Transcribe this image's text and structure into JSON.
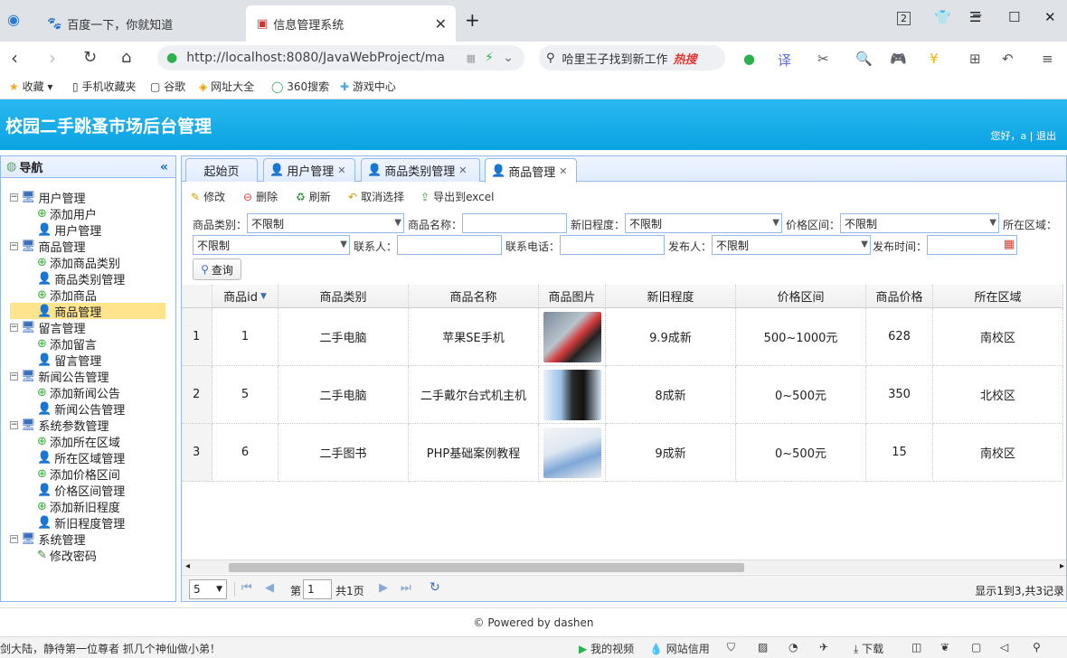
{
  "browser": {
    "tabs": [
      {
        "label": "百度一下，你就知道"
      },
      {
        "label": "信息管理系统"
      }
    ],
    "new_tab": "+",
    "tab_count": "2",
    "url": "http://localhost:8080/JavaWebProject/ma",
    "search_text": "哈里王子找到新工作",
    "search_hot": "热搜"
  },
  "bookmarks": [
    {
      "label": "收藏"
    },
    {
      "label": "手机收藏夹"
    },
    {
      "label": "谷歌"
    },
    {
      "label": "网址大全"
    },
    {
      "label": "360搜索"
    },
    {
      "label": "游戏中心"
    }
  ],
  "app": {
    "title": "校园二手跳蚤市场后台管理",
    "greeting": "您好，a",
    "logout": "退出"
  },
  "sidebar": {
    "title": "导航",
    "tree": [
      {
        "label": "用户管理",
        "children": [
          {
            "label": "添加用户"
          },
          {
            "label": "用户管理"
          }
        ]
      },
      {
        "label": "商品管理",
        "children": [
          {
            "label": "添加商品类别"
          },
          {
            "label": "商品类别管理"
          },
          {
            "label": "添加商品"
          },
          {
            "label": "商品管理"
          }
        ]
      },
      {
        "label": "留言管理",
        "children": [
          {
            "label": "添加留言"
          },
          {
            "label": "留言管理"
          }
        ]
      },
      {
        "label": "新闻公告管理",
        "children": [
          {
            "label": "添加新闻公告"
          },
          {
            "label": "新闻公告管理"
          }
        ]
      },
      {
        "label": "系统参数管理",
        "children": [
          {
            "label": "添加所在区域"
          },
          {
            "label": "所在区域管理"
          },
          {
            "label": "添加价格区间"
          },
          {
            "label": "价格区间管理"
          },
          {
            "label": "添加新旧程度"
          },
          {
            "label": "新旧程度管理"
          }
        ]
      },
      {
        "label": "系统管理",
        "children": [
          {
            "label": "修改密码"
          }
        ]
      }
    ]
  },
  "main_tabs": [
    {
      "label": "起始页"
    },
    {
      "label": "用户管理"
    },
    {
      "label": "商品类别管理"
    },
    {
      "label": "商品管理"
    }
  ],
  "toolbar": {
    "edit": "修改",
    "delete": "删除",
    "refresh": "刷新",
    "cancel": "取消选择",
    "export": "导出到excel"
  },
  "filters": {
    "category_label": "商品类别：",
    "category_value": "不限制",
    "name_label": "商品名称：",
    "condition_label": "新旧程度：",
    "condition_value": "不限制",
    "price_label": "价格区间：",
    "price_value": "不限制",
    "area_label": "所在区域：",
    "area_value": "不限制",
    "contact_label": "联系人：",
    "phone_label": "联系电话：",
    "publisher_label": "发布人：",
    "publisher_value": "不限制",
    "time_label": "发布时间：",
    "query": "查询"
  },
  "grid": {
    "headers": [
      "商品id",
      "商品类别",
      "商品名称",
      "商品图片",
      "新旧程度",
      "价格区间",
      "商品价格",
      "所在区域"
    ],
    "rows": [
      {
        "n": "1",
        "id": "1",
        "cat": "二手电脑",
        "name": "苹果SE手机",
        "cond": "9.9成新",
        "range": "500~1000元",
        "price": "628",
        "area": "南校区"
      },
      {
        "n": "2",
        "id": "5",
        "cat": "二手电脑",
        "name": "二手戴尔台式机主机",
        "cond": "8成新",
        "range": "0~500元",
        "price": "350",
        "area": "北校区"
      },
      {
        "n": "3",
        "id": "6",
        "cat": "二手图书",
        "name": "PHP基础案例教程",
        "cond": "9成新",
        "range": "0~500元",
        "price": "15",
        "area": "南校区"
      }
    ]
  },
  "pager": {
    "size": "5",
    "page_prefix": "第",
    "page": "1",
    "total_pages": "共1页",
    "summary": "显示1到3,共3记录"
  },
  "footer": "© Powered by dashen",
  "status": {
    "left": "剑大陆，静待第一位尊者 抓几个神仙做小弟！",
    "video": "我的视频",
    "credit": "网站信用",
    "download": "下载"
  }
}
